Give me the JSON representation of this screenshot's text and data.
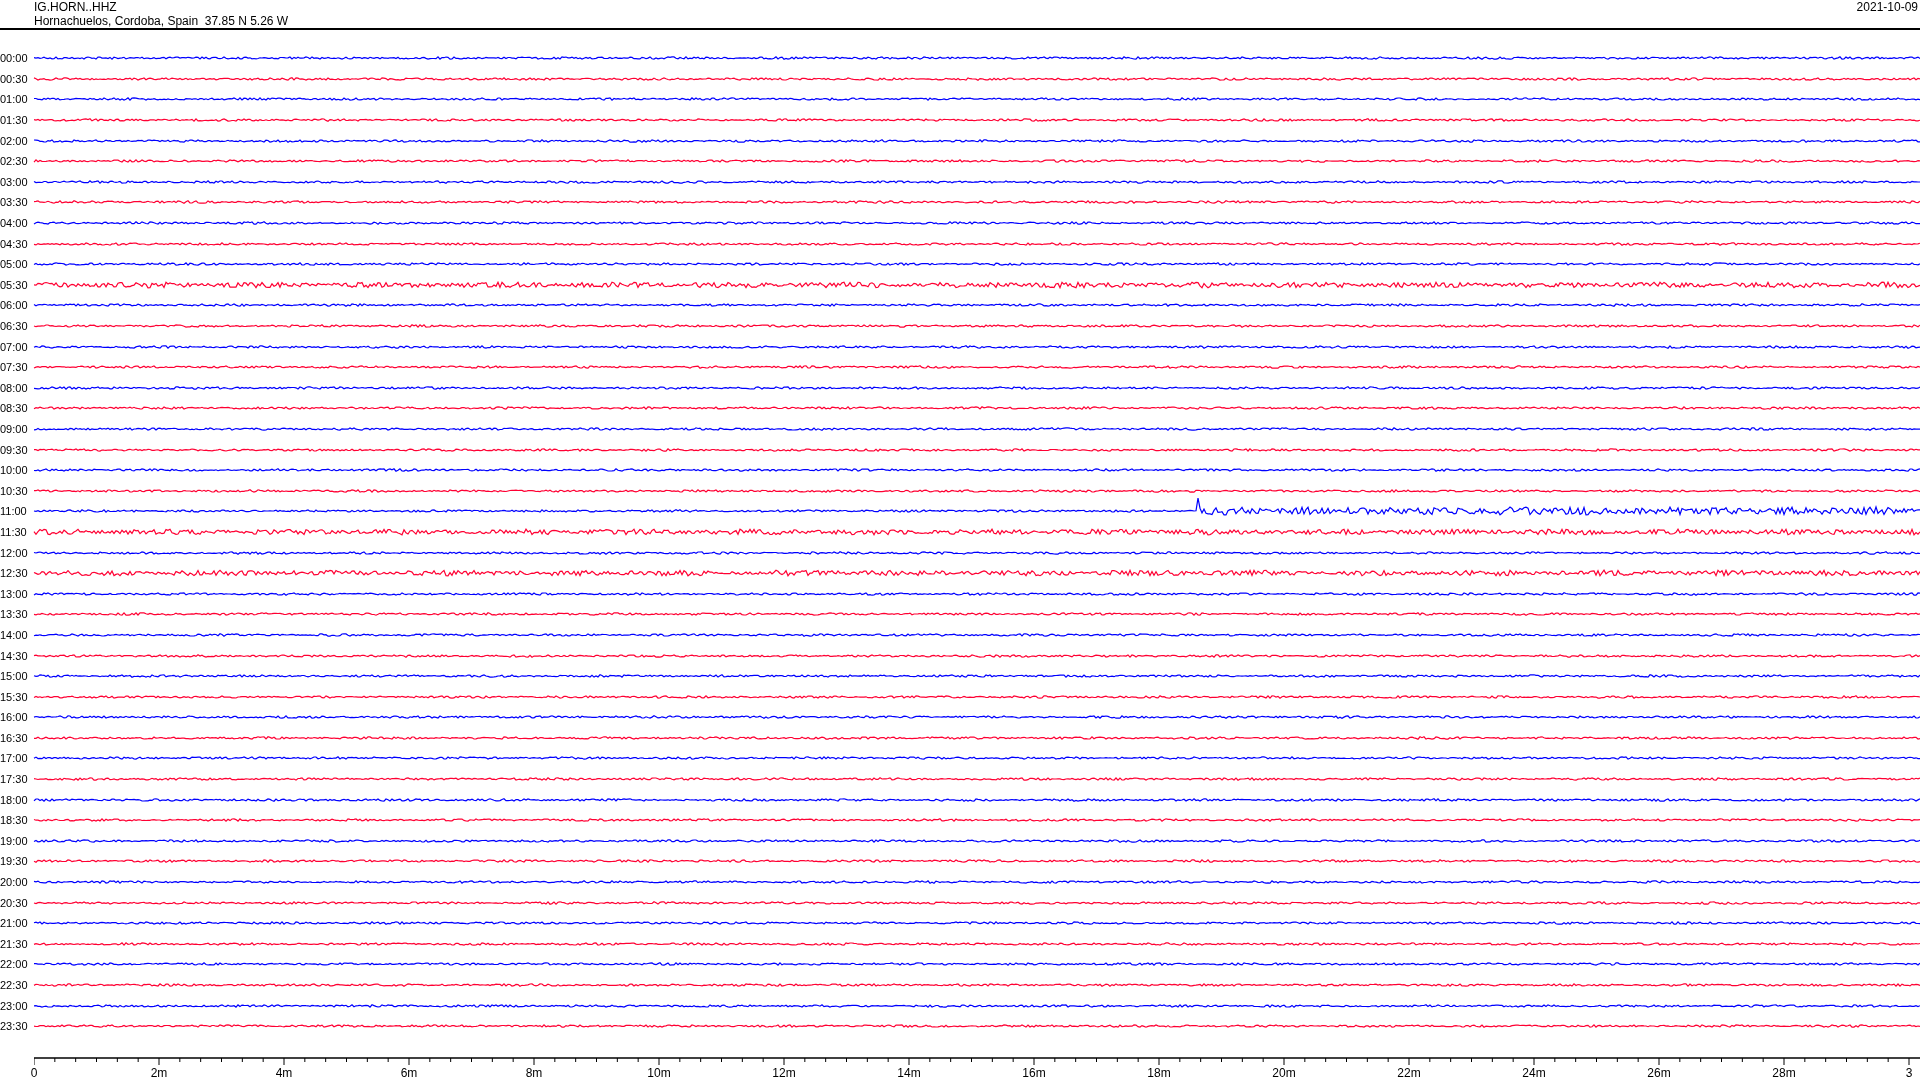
{
  "header": {
    "station": "IG.HORN..HHZ",
    "location": "Hornachuelos, Cordoba, Spain  37.85 N 5.26 W",
    "date": "2021-10-09"
  },
  "traces": [
    {
      "label": "00:00",
      "color": "#0000ff",
      "kind": "quiet"
    },
    {
      "label": "00:30",
      "color": "#ff0033",
      "kind": "quiet"
    },
    {
      "label": "01:00",
      "color": "#0000ff",
      "kind": "quiet"
    },
    {
      "label": "01:30",
      "color": "#ff0033",
      "kind": "quiet"
    },
    {
      "label": "02:00",
      "color": "#0000ff",
      "kind": "quiet"
    },
    {
      "label": "02:30",
      "color": "#ff0033",
      "kind": "quiet"
    },
    {
      "label": "03:00",
      "color": "#0000ff",
      "kind": "quiet"
    },
    {
      "label": "03:30",
      "color": "#ff0033",
      "kind": "quiet"
    },
    {
      "label": "04:00",
      "color": "#0000ff",
      "kind": "quiet"
    },
    {
      "label": "04:30",
      "color": "#ff0033",
      "kind": "quiet"
    },
    {
      "label": "05:00",
      "color": "#0000ff",
      "kind": "quiet"
    },
    {
      "label": "05:30",
      "color": "#ff0033",
      "kind": "noisy"
    },
    {
      "label": "06:00",
      "color": "#0000ff",
      "kind": "quiet"
    },
    {
      "label": "06:30",
      "color": "#ff0033",
      "kind": "quiet"
    },
    {
      "label": "07:00",
      "color": "#0000ff",
      "kind": "quiet"
    },
    {
      "label": "07:30",
      "color": "#ff0033",
      "kind": "quiet"
    },
    {
      "label": "08:00",
      "color": "#0000ff",
      "kind": "quiet"
    },
    {
      "label": "08:30",
      "color": "#ff0033",
      "kind": "quiet"
    },
    {
      "label": "09:00",
      "color": "#0000ff",
      "kind": "quiet"
    },
    {
      "label": "09:30",
      "color": "#ff0033",
      "kind": "quiet"
    },
    {
      "label": "10:00",
      "color": "#0000ff",
      "kind": "quiet"
    },
    {
      "label": "10:30",
      "color": "#ff0033",
      "kind": "quiet"
    },
    {
      "label": "11:00",
      "color": "#0000ff",
      "kind": "event"
    },
    {
      "label": "11:30",
      "color": "#ff0033",
      "kind": "noisy"
    },
    {
      "label": "12:00",
      "color": "#0000ff",
      "kind": "quiet"
    },
    {
      "label": "12:30",
      "color": "#ff0033",
      "kind": "noisy"
    },
    {
      "label": "13:00",
      "color": "#0000ff",
      "kind": "quiet"
    },
    {
      "label": "13:30",
      "color": "#ff0033",
      "kind": "quiet"
    },
    {
      "label": "14:00",
      "color": "#0000ff",
      "kind": "quiet"
    },
    {
      "label": "14:30",
      "color": "#ff0033",
      "kind": "quiet"
    },
    {
      "label": "15:00",
      "color": "#0000ff",
      "kind": "quiet"
    },
    {
      "label": "15:30",
      "color": "#ff0033",
      "kind": "quiet"
    },
    {
      "label": "16:00",
      "color": "#0000ff",
      "kind": "quiet"
    },
    {
      "label": "16:30",
      "color": "#ff0033",
      "kind": "quiet"
    },
    {
      "label": "17:00",
      "color": "#0000ff",
      "kind": "quiet"
    },
    {
      "label": "17:30",
      "color": "#ff0033",
      "kind": "quiet"
    },
    {
      "label": "18:00",
      "color": "#0000ff",
      "kind": "quiet"
    },
    {
      "label": "18:30",
      "color": "#ff0033",
      "kind": "quiet"
    },
    {
      "label": "19:00",
      "color": "#0000ff",
      "kind": "quiet"
    },
    {
      "label": "19:30",
      "color": "#ff0033",
      "kind": "quiet"
    },
    {
      "label": "20:00",
      "color": "#0000ff",
      "kind": "quiet"
    },
    {
      "label": "20:30",
      "color": "#ff0033",
      "kind": "quiet"
    },
    {
      "label": "21:00",
      "color": "#0000ff",
      "kind": "quiet"
    },
    {
      "label": "21:30",
      "color": "#ff0033",
      "kind": "quiet"
    },
    {
      "label": "22:00",
      "color": "#0000ff",
      "kind": "quiet"
    },
    {
      "label": "22:30",
      "color": "#ff0033",
      "kind": "quiet"
    },
    {
      "label": "23:00",
      "color": "#0000ff",
      "kind": "quiet"
    },
    {
      "label": "23:30",
      "color": "#ff0033",
      "kind": "quiet"
    }
  ],
  "x_axis": {
    "ticks": [
      "0",
      "2m",
      "4m",
      "6m",
      "8m",
      "10m",
      "12m",
      "14m",
      "16m",
      "18m",
      "20m",
      "22m",
      "24m",
      "26m",
      "28m",
      "3"
    ]
  }
}
